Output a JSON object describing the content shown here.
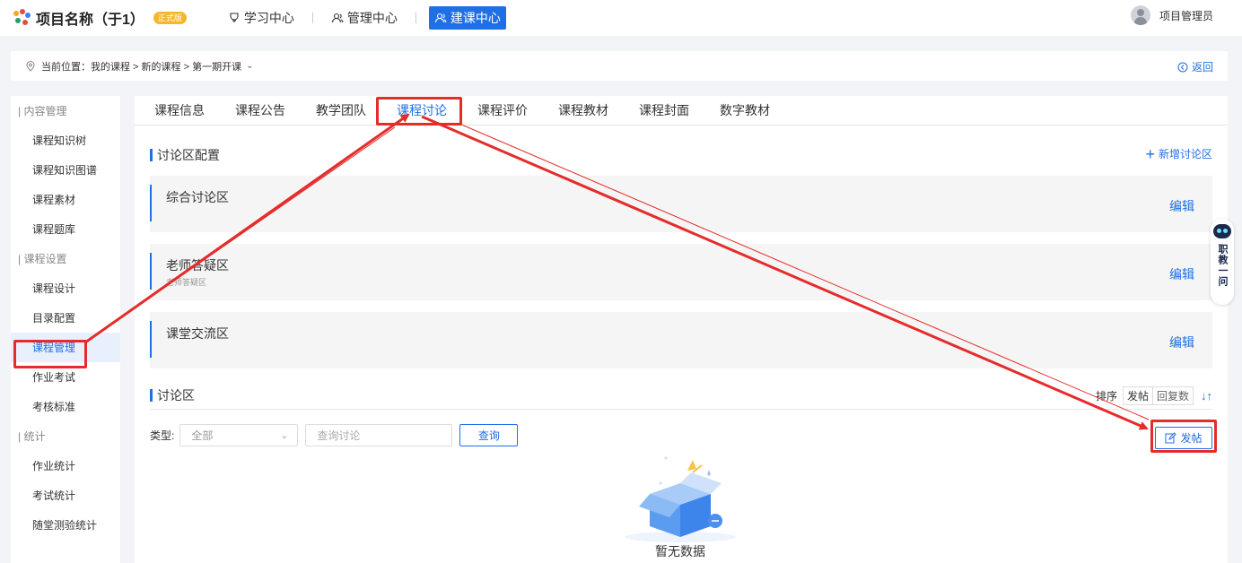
{
  "header": {
    "title": "项目名称（于1）",
    "badge": "正式版",
    "nav": [
      {
        "label": "学习中心",
        "icon": "learning-icon"
      },
      {
        "label": "管理中心",
        "icon": "users-icon"
      },
      {
        "label": "建课中心",
        "icon": "build-icon",
        "active": true
      }
    ],
    "user_name": "项目管理员"
  },
  "breadcrumb": {
    "text": "当前位置：我的课程 > 新的课程 > 第一期开课",
    "back_label": "返回"
  },
  "sidebar": {
    "groups": [
      {
        "label": "| 内容管理",
        "items": [
          "课程知识树",
          "课程知识图谱",
          "课程素材",
          "课程题库"
        ]
      },
      {
        "label": "| 课程设置",
        "items": [
          "课程设计",
          "目录配置",
          "课程管理",
          "作业考试",
          "考核标准"
        ]
      },
      {
        "label": "| 统计",
        "items": [
          "作业统计",
          "考试统计",
          "随堂测验统计"
        ]
      }
    ],
    "active_item": "课程管理"
  },
  "tabs": [
    "课程信息",
    "课程公告",
    "教学团队",
    "课程讨论",
    "课程评价",
    "课程教材",
    "课程封面",
    "数字教材"
  ],
  "active_tab": "课程讨论",
  "config": {
    "title": "讨论区配置",
    "add_label": "新增讨论区",
    "zones": [
      {
        "name": "综合讨论区",
        "subtitle": "",
        "edit": "编辑"
      },
      {
        "name": "老师答疑区",
        "subtitle": "老师答疑区",
        "edit": "编辑"
      },
      {
        "name": "课堂交流区",
        "subtitle": "",
        "edit": "编辑"
      }
    ]
  },
  "discussion": {
    "title": "讨论区",
    "sort_label": "排序",
    "sort_options": [
      "发帖",
      "回复数"
    ],
    "type_label": "类型:",
    "type_value": "全部",
    "search_placeholder": "查询讨论",
    "query_label": "查询",
    "post_label": "发帖",
    "empty_text": "暂无数据"
  },
  "assistant": {
    "label": "职教一问"
  },
  "colors": {
    "primary": "#1f6fe5",
    "highlight": "#e62b2b"
  }
}
